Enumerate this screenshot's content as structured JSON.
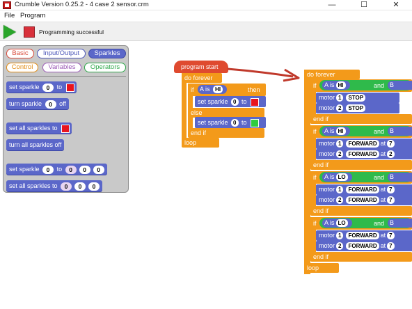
{
  "window": {
    "title": "Crumble Version 0.25.2 - 4 case 2 sensor.crm",
    "min_glyph": "—",
    "max_glyph": "☐",
    "close_glyph": "✕"
  },
  "menu": {
    "file": "File",
    "program": "Program"
  },
  "toolbar": {
    "status": "Programming successful"
  },
  "palette": {
    "categories": {
      "basic": "Basic",
      "io": "Input/Output",
      "sparkles": "Sparkles",
      "control": "Control",
      "variables": "Variables",
      "operators": "Operators"
    },
    "blocks": [
      {
        "label": "set sparkle",
        "num": "0",
        "to": "to",
        "color": "#e8151e"
      },
      {
        "label": "turn sparkle",
        "num": "0",
        "suffix": "off"
      },
      {
        "label": "set all sparkles to",
        "color": "#e8151e"
      },
      {
        "label": "turn all sparkles off"
      },
      {
        "label": "set sparkle",
        "num": "0",
        "to": "to",
        "r": "0",
        "g": "0",
        "b": "0"
      },
      {
        "label": "set all sparkles to",
        "r": "0",
        "g": "0",
        "b": "0"
      }
    ]
  },
  "script1": {
    "hat": "program start",
    "do_forever": "do forever",
    "if": "if",
    "a": "A",
    "is": "is",
    "hi": "HI",
    "then": "then",
    "set_sparkle": "set sparkle",
    "num": "0",
    "to": "to",
    "color_red": "#e8151e",
    "color_green": "#2ecc40",
    "else": "else",
    "end_if": "end if",
    "loop": "loop"
  },
  "script2": {
    "do_forever": "do forever",
    "loop": "loop",
    "if_kw": "if",
    "and_kw": "and",
    "is_kw": "is",
    "end_if": "end if",
    "motor_kw": "motor",
    "at_kw": "at",
    "cases": [
      {
        "a": "A",
        "a_val": "HI",
        "b": "B",
        "m1_num": "1",
        "m1_act": "STOP",
        "m2_num": "2",
        "m2_act": "STOP"
      },
      {
        "a": "A",
        "a_val": "HI",
        "b": "B",
        "m1_num": "1",
        "m1_act": "FORWARD",
        "m1_at": "7",
        "m2_num": "2",
        "m2_act": "FORWARD",
        "m2_at": "2"
      },
      {
        "a": "A",
        "a_val": "LO",
        "b": "B",
        "m1_num": "1",
        "m1_act": "FORWARD",
        "m1_at": "7",
        "m2_num": "2",
        "m2_act": "FORWARD",
        "m2_at": "7"
      },
      {
        "a": "A",
        "a_val": "LO",
        "b": "B",
        "m1_num": "1",
        "m1_act": "FORWARD",
        "m1_at": "7",
        "m2_num": "2",
        "m2_act": "FORWARD",
        "m2_at": "7"
      }
    ]
  },
  "colors": {
    "accent_blue": "#5b67c9",
    "control_orange": "#f39a1a",
    "hat_red": "#df4a2f",
    "condition_green": "#2fba4b",
    "arrow_red": "#c0392b"
  }
}
